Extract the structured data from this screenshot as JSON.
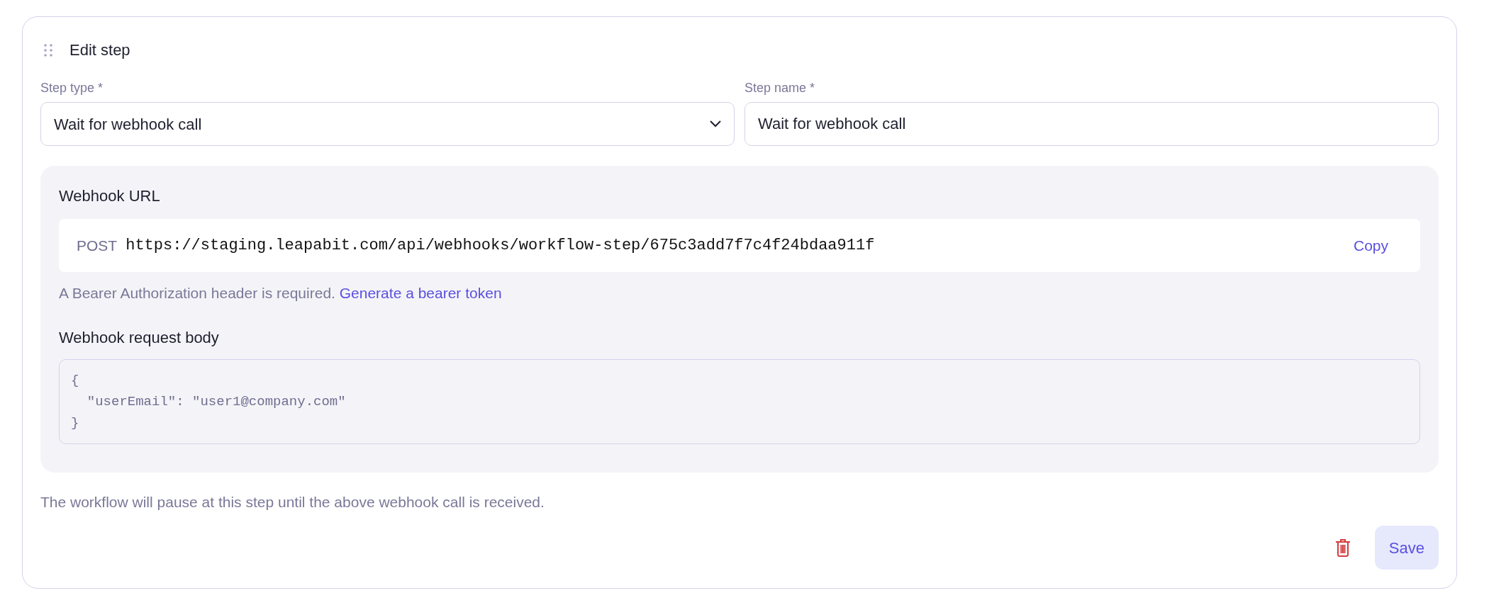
{
  "card": {
    "title": "Edit step"
  },
  "fields": [
    {
      "kind": "select",
      "label": "Step type *",
      "value": "Wait for webhook call"
    },
    {
      "kind": "text",
      "label": "Step name *",
      "value": "Wait for webhook call"
    }
  ],
  "webhook": {
    "heading": "Webhook URL",
    "method": "POST",
    "url": "https://staging.leapabit.com/api/webhooks/workflow-step/675c3add7f7c4f24bdaa911f",
    "copy_button": "Copy",
    "auth_note": "A Bearer Authorization header is required.",
    "auth_link": "Generate a bearer token",
    "body_heading": "Webhook request body",
    "body_lines": [
      "{",
      "  \"userEmail\": \"user1@company.com\"",
      "}"
    ]
  },
  "footer_note": "The workflow will pause at this step until the above webhook call is received.",
  "actions": {
    "save": "Save"
  }
}
